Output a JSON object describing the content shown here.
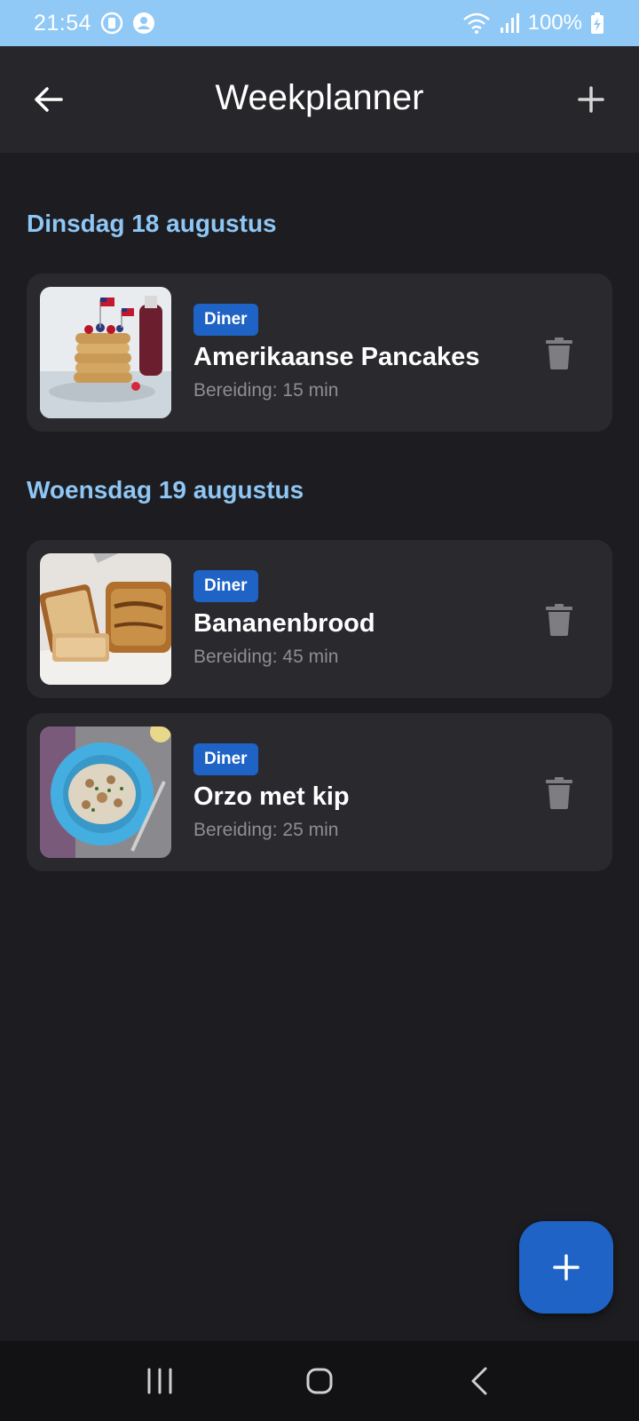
{
  "status_bar": {
    "time": "21:54",
    "battery": "100%",
    "icons": [
      "sim-icon",
      "account-icon",
      "wifi-icon",
      "signal-icon",
      "battery-charging-icon"
    ]
  },
  "app_bar": {
    "title": "Weekplanner",
    "back_icon": "arrow-left-icon",
    "add_icon": "plus-icon"
  },
  "days": [
    {
      "heading": "Dinsdag 18 augustus",
      "meals": [
        {
          "tag": "Diner",
          "title": "Amerikaanse Pancakes",
          "prep": "Bereiding: 15 min",
          "image": "pancakes"
        }
      ]
    },
    {
      "heading": "Woensdag 19 augustus",
      "meals": [
        {
          "tag": "Diner",
          "title": "Bananenbrood",
          "prep": "Bereiding: 45 min",
          "image": "banana-bread"
        },
        {
          "tag": "Diner",
          "title": "Orzo met kip",
          "prep": "Bereiding: 25 min",
          "image": "orzo"
        }
      ]
    }
  ],
  "fab": {
    "icon": "plus-icon"
  },
  "nav_bar": {
    "icons": [
      "recent-apps-icon",
      "home-icon",
      "back-icon"
    ]
  },
  "colors": {
    "background": "#1d1d21",
    "app_bar": "#27272b",
    "card": "#29292e",
    "accent": "#1e63c5",
    "heading": "#8ec6f5",
    "status_bar": "#90c8f6"
  }
}
